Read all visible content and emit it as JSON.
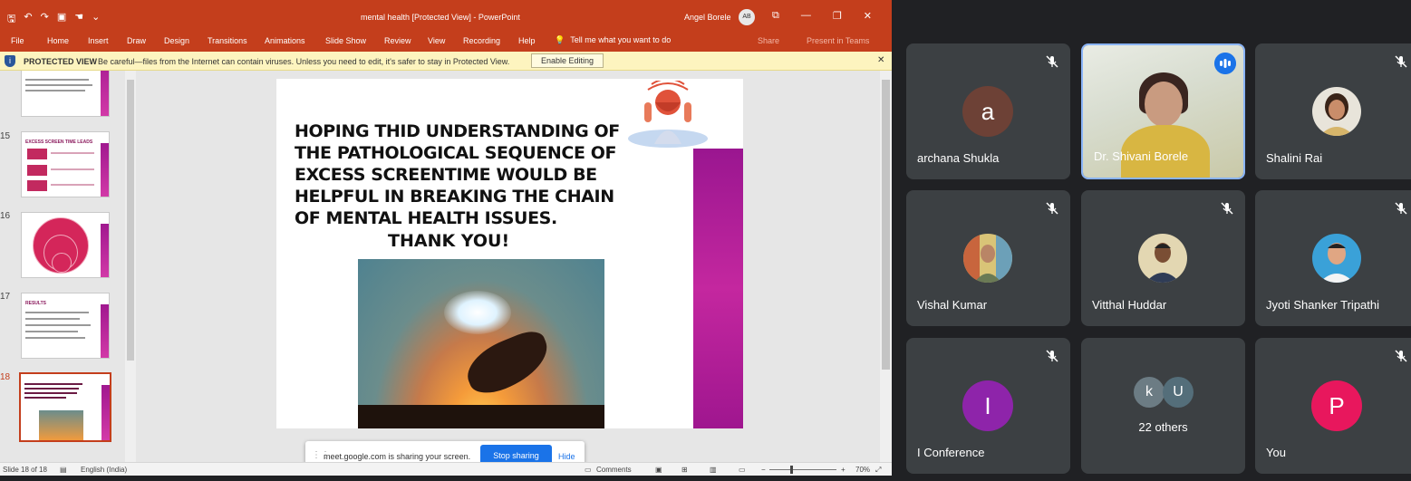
{
  "ppt": {
    "quick_access_icons": [
      "save-icon",
      "undo-icon",
      "redo-icon",
      "present-icon",
      "touch-icon",
      "customize-icon"
    ],
    "doc_title": "mental health [Protected View]  -  PowerPoint",
    "user_name": "Angel Borele",
    "user_initials": "AB",
    "menu": [
      "File",
      "Home",
      "Insert",
      "Draw",
      "Design",
      "Transitions",
      "Animations",
      "Slide Show",
      "Review",
      "View",
      "Recording",
      "Help"
    ],
    "tell_me": "Tell me what you want to do",
    "share": "Share",
    "present_in_teams": "Present in Teams",
    "protected_view": {
      "title": "PROTECTED VIEW",
      "message": "Be careful—files from the Internet can contain viruses. Unless you need to edit, it's safer to stay in Protected View.",
      "button": "Enable Editing"
    },
    "thumbnails": [
      {
        "num": "15",
        "title": "EXCESS SCREEN TIME LEADS"
      },
      {
        "num": "16"
      },
      {
        "num": "17",
        "title": "RESULTS"
      },
      {
        "num": "18"
      }
    ],
    "slide": {
      "body": "HOPING THID UNDERSTANDING OF THE PATHOLOGICAL SEQUENCE OF EXCESS SCREENTIME WOULD BE HELPFUL IN BREAKING THE CHAIN OF MENTAL HEALTH ISSUES.",
      "thanks": "THANK YOU!"
    },
    "share_notice": {
      "text": "meet.google.com is sharing your screen.",
      "stop": "Stop sharing",
      "hide": "Hide"
    },
    "status": {
      "slide_of": "Slide 18 of 18",
      "language": "English (India)",
      "comments": "Comments",
      "zoom": "70%"
    }
  },
  "meet": {
    "participants": [
      {
        "name": "archana Shukla",
        "initial": "a",
        "color": "#6d4136",
        "muted": true
      },
      {
        "name": "Dr. Shivani Borele",
        "speaking": true
      },
      {
        "name": "Shalini Rai",
        "muted": true
      },
      {
        "name": "Vishal Kumar",
        "muted": true
      },
      {
        "name": "Vitthal Huddar",
        "muted": true
      },
      {
        "name": "Jyoti Shanker Tripathi",
        "muted": true
      },
      {
        "name": "I Conference",
        "initial": "I",
        "color": "#8e24aa",
        "muted": true
      },
      {
        "name": "22 others",
        "initials": [
          "k",
          "U"
        ]
      },
      {
        "name": "You",
        "initial": "P",
        "color": "#e8175d",
        "muted": true
      }
    ]
  }
}
